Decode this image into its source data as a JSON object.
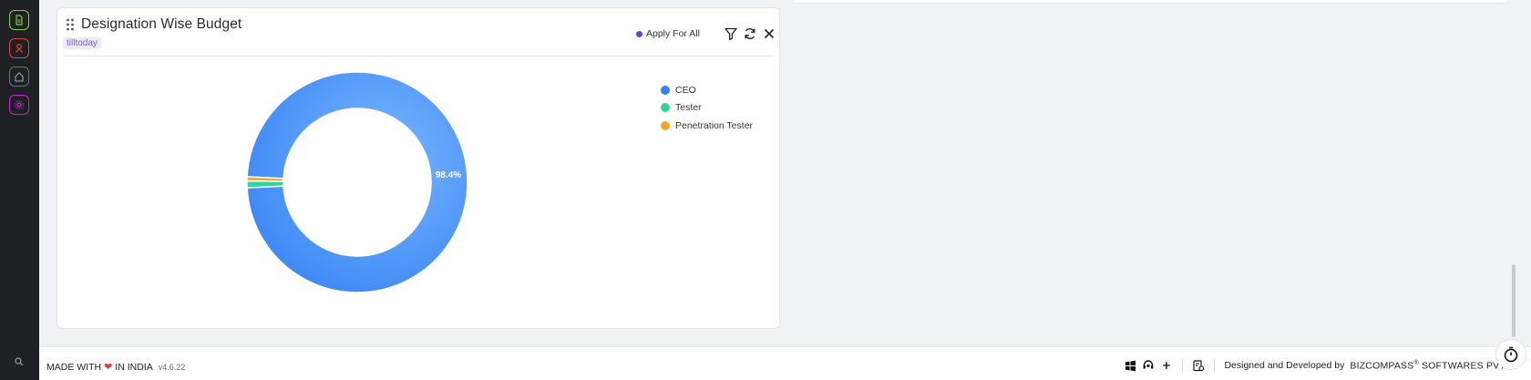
{
  "sidebar": {
    "items": [
      {
        "name": "document-icon",
        "color": "#7bd23a"
      },
      {
        "name": "recruit-icon",
        "color": "#e0452f"
      },
      {
        "name": "home-icon",
        "color": "#9ca3af"
      },
      {
        "name": "settings-icon",
        "color": "#c026d3"
      },
      {
        "name": "search-icon",
        "color": "#9ca3af"
      }
    ]
  },
  "widget": {
    "title": "Designation Wise Budget",
    "tag": "tilltoday",
    "apply_for_all_label": "Apply For All",
    "icons": [
      "drag-handle-icon",
      "filter-icon",
      "refresh-icon",
      "close-icon"
    ]
  },
  "chart_data": {
    "type": "pie",
    "variant": "donut",
    "labels": [
      "CEO",
      "Tester",
      "Penetration Tester"
    ],
    "values": [
      98.4,
      1.0,
      0.6
    ],
    "colors": [
      "#3b82f6",
      "#34d399",
      "#f5a524"
    ],
    "data_labels": [
      "98.4%",
      "",
      ""
    ],
    "legend_position": "top-right"
  },
  "footer": {
    "made_with": "MADE WITH",
    "in_india": "IN INDIA",
    "version": "v4.6.22",
    "designed_by": "Designed and Developed by",
    "brand": "BIZCOMPASS",
    "brand_sup": "®",
    "brand_suffix": "SOFTWARES PVT",
    "icons": [
      "windows-icon",
      "support-icon",
      "add-icon",
      "clipboard-icon"
    ]
  }
}
